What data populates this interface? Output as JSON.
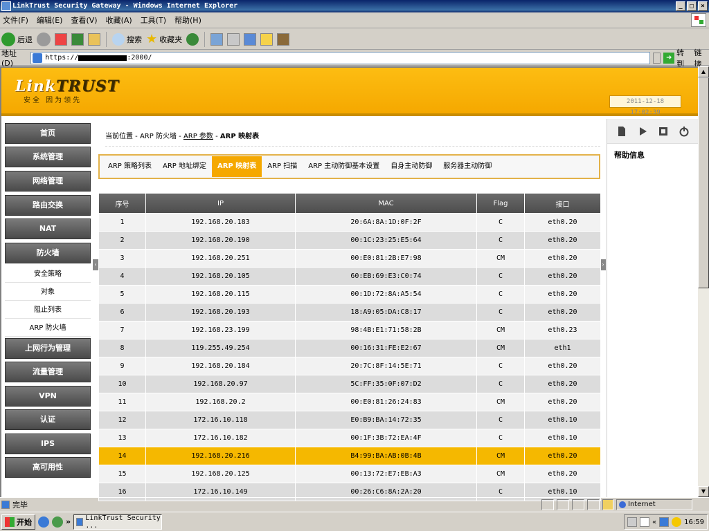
{
  "browser": {
    "title": "LinkTrust Security Gateway - Windows Internet Explorer",
    "menu": [
      "文件(F)",
      "编辑(E)",
      "查看(V)",
      "收藏(A)",
      "工具(T)",
      "帮助(H)"
    ],
    "toolbar": {
      "back": "后退",
      "search": "搜索",
      "favorites": "收藏夹"
    },
    "address_label": "地址(D)",
    "url_prefix": "https://",
    "url_suffix": ":2000/",
    "go": "转到",
    "links": "链接",
    "status": "完毕",
    "zone": "Internet"
  },
  "taskbar": {
    "start": "开始",
    "task": "LinkTrust Security ...",
    "clock": "16:59"
  },
  "header": {
    "logo_a": "Link",
    "logo_b": "TRUST",
    "slogan": "安全 因为领先",
    "datetime": "2011-12-18 17:02:39"
  },
  "nav": {
    "items": [
      "首页",
      "系统管理",
      "网络管理",
      "路由交换",
      "NAT",
      "防火墙"
    ],
    "subitems": [
      "安全策略",
      "对象",
      "阻止列表",
      "ARP 防火墙"
    ],
    "items2": [
      "上网行为管理",
      "流量管理",
      "VPN",
      "认证",
      "IPS",
      "高可用性"
    ]
  },
  "breadcrumb": {
    "prefix": "当前位置 - ",
    "l1": "ARP 防火墙",
    "sep": " - ",
    "l2": "ARP 参数",
    "l3": "ARP 映射表"
  },
  "tabs": [
    "ARP 策略列表",
    "ARP 地址绑定",
    "ARP 映射表",
    "ARP 扫描",
    "ARP 主动防御基本设置",
    "自身主动防御",
    "服务器主动防御"
  ],
  "active_tab": 2,
  "table": {
    "columns": [
      "序号",
      "IP",
      "MAC",
      "Flag",
      "接口"
    ],
    "highlight_row": 13,
    "rows": [
      [
        "1",
        "192.168.20.183",
        "20:6A:8A:1D:0F:2F",
        "C",
        "eth0.20"
      ],
      [
        "2",
        "192.168.20.190",
        "00:1C:23:25:E5:64",
        "C",
        "eth0.20"
      ],
      [
        "3",
        "192.168.20.251",
        "00:E0:81:2B:E7:98",
        "CM",
        "eth0.20"
      ],
      [
        "4",
        "192.168.20.105",
        "60:EB:69:E3:C0:74",
        "C",
        "eth0.20"
      ],
      [
        "5",
        "192.168.20.115",
        "00:1D:72:8A:A5:54",
        "C",
        "eth0.20"
      ],
      [
        "6",
        "192.168.20.193",
        "18:A9:05:DA:C8:17",
        "C",
        "eth0.20"
      ],
      [
        "7",
        "192.168.23.199",
        "98:4B:E1:71:58:2B",
        "CM",
        "eth0.23"
      ],
      [
        "8",
        "119.255.49.254",
        "00:16:31:FE:E2:67",
        "CM",
        "eth1"
      ],
      [
        "9",
        "192.168.20.184",
        "20:7C:8F:14:5E:71",
        "C",
        "eth0.20"
      ],
      [
        "10",
        "192.168.20.97",
        "5C:FF:35:0F:07:D2",
        "C",
        "eth0.20"
      ],
      [
        "11",
        "192.168.20.2",
        "00:E0:81:26:24:83",
        "CM",
        "eth0.20"
      ],
      [
        "12",
        "172.16.10.118",
        "E0:B9:BA:14:72:35",
        "C",
        "eth0.10"
      ],
      [
        "13",
        "172.16.10.182",
        "00:1F:3B:72:EA:4F",
        "C",
        "eth0.10"
      ],
      [
        "14",
        "192.168.20.216",
        "B4:99:BA:AB:0B:4B",
        "CM",
        "eth0.20"
      ],
      [
        "15",
        "192.168.20.125",
        "00:13:72:E7:EB:A3",
        "CM",
        "eth0.20"
      ],
      [
        "16",
        "172.16.10.149",
        "00:26:C6:8A:2A:20",
        "C",
        "eth0.10"
      ]
    ]
  },
  "right_panel": {
    "title": "帮助信息"
  },
  "colors": {
    "accent": "#f5a800",
    "nav": "#4a4a4a"
  }
}
